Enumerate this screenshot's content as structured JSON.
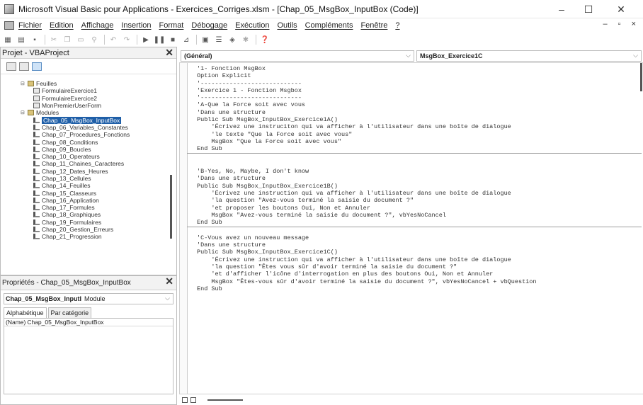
{
  "window": {
    "title": "Microsoft Visual Basic pour Applications - Exercices_Corriges.xlsm - [Chap_05_MsgBox_InputBox (Code)]",
    "controls": {
      "minimize": "–",
      "maximize": "☐",
      "close": "✕"
    }
  },
  "menubar": {
    "items": [
      "Fichier",
      "Edition",
      "Affichage",
      "Insertion",
      "Format",
      "Débogage",
      "Exécution",
      "Outils",
      "Compléments",
      "Fenêtre",
      "?"
    ],
    "mdi_controls": "– ▫ ×"
  },
  "project_panel": {
    "title": "Projet - VBAProject",
    "close": "✕",
    "tree": [
      {
        "level": 1,
        "type": "folder",
        "label": "Feuilles",
        "expander": "⊟"
      },
      {
        "level": 2,
        "type": "form",
        "label": "FormulaireExercice1"
      },
      {
        "level": 2,
        "type": "form",
        "label": "FormulaireExercice2"
      },
      {
        "level": 2,
        "type": "form",
        "label": "MonPremierUserForm"
      },
      {
        "level": 1,
        "type": "folder",
        "label": "Modules",
        "expander": "⊟"
      },
      {
        "level": 2,
        "type": "module",
        "label": "Chap_05_MsgBox_InputBox",
        "selected": true
      },
      {
        "level": 2,
        "type": "module",
        "label": "Chap_06_Variables_Constantes"
      },
      {
        "level": 2,
        "type": "module",
        "label": "Chap_07_Procedures_Fonctions"
      },
      {
        "level": 2,
        "type": "module",
        "label": "Chap_08_Conditions"
      },
      {
        "level": 2,
        "type": "module",
        "label": "Chap_09_Boucles"
      },
      {
        "level": 2,
        "type": "module",
        "label": "Chap_10_Operateurs"
      },
      {
        "level": 2,
        "type": "module",
        "label": "Chap_11_Chaines_Caracteres"
      },
      {
        "level": 2,
        "type": "module",
        "label": "Chap_12_Dates_Heures"
      },
      {
        "level": 2,
        "type": "module",
        "label": "Chap_13_Cellules"
      },
      {
        "level": 2,
        "type": "module",
        "label": "Chap_14_Feuilles"
      },
      {
        "level": 2,
        "type": "module",
        "label": "Chap_15_Classeurs"
      },
      {
        "level": 2,
        "type": "module",
        "label": "Chap_16_Application"
      },
      {
        "level": 2,
        "type": "module",
        "label": "Chap_17_Formules"
      },
      {
        "level": 2,
        "type": "module",
        "label": "Chap_18_Graphiques"
      },
      {
        "level": 2,
        "type": "module",
        "label": "Chap_19_Formulaires"
      },
      {
        "level": 2,
        "type": "module",
        "label": "Chap_20_Gestion_Erreurs"
      },
      {
        "level": 2,
        "type": "module",
        "label": "Chap_21_Progression"
      }
    ]
  },
  "properties_panel": {
    "title": "Propriétés - Chap_05_MsgBox_InputBox",
    "close": "✕",
    "object_name": "Chap_05_MsgBox_InputI",
    "object_type": "Module",
    "tabs": [
      "Alphabétique",
      "Par catégorie"
    ],
    "rows": [
      {
        "name": "(Name)",
        "value": "Chap_05_MsgBox_InputBox"
      }
    ]
  },
  "code_window": {
    "object_combo": "(Général)",
    "procedure_combo": "MsgBox_Exercice1C",
    "blocks": [
      [
        "'1- Fonction MsgBox",
        "Option Explicit",
        "'----------------------------",
        "'Exercice 1 - Fonction Msgbox",
        "'----------------------------",
        "'A-Que la Force soit avec vous",
        "'Dans une structure",
        "Public Sub MsgBox_InputBox_Exercice1A()",
        "    'Écrivez une instruciton qui va afficher à l'utilisateur dans une boîte de dialogue",
        "    'le texte \"Que la Force soit avec vous\"",
        "    MsgBox \"Que la Force soit avec vous\"",
        "End Sub"
      ],
      [
        "",
        "",
        "'B-Yes, No, Maybe, I don't know",
        "'Dans une structure",
        "Public Sub MsgBox_InputBox_Exercice1B()",
        "    'Écrivez une instruction qui va afficher à l'utilisateur dans une boîte de dialogue",
        "    'la question \"Avez-vous terminé la saisie du document ?\"",
        "    'et proposer les boutons Oui, Non et Annuler",
        "    MsgBox \"Avez-vous terminé la saisie du document ?\", vbYesNoCancel",
        "End Sub"
      ],
      [
        "",
        "'C-Vous avez un nouveau message",
        "'Dans une structure",
        "Public Sub MsgBox_InputBox_Exercice1C()",
        "    'Écrivez une instruction qui va afficher à l'utilisateur dans une boîte de dialogue",
        "    'la question \"Êtes vous sûr d'avoir terminé la saisie du document ?\"",
        "    'et d'afficher l'icône d'interrogation en plus des boutons Oui, Non et Annuler",
        "    MsgBox \"Êtes-vous sûr d'avoir terminé la saisie du document ?\", vbYesNoCancel + vbQuestion",
        "End Sub"
      ]
    ]
  }
}
